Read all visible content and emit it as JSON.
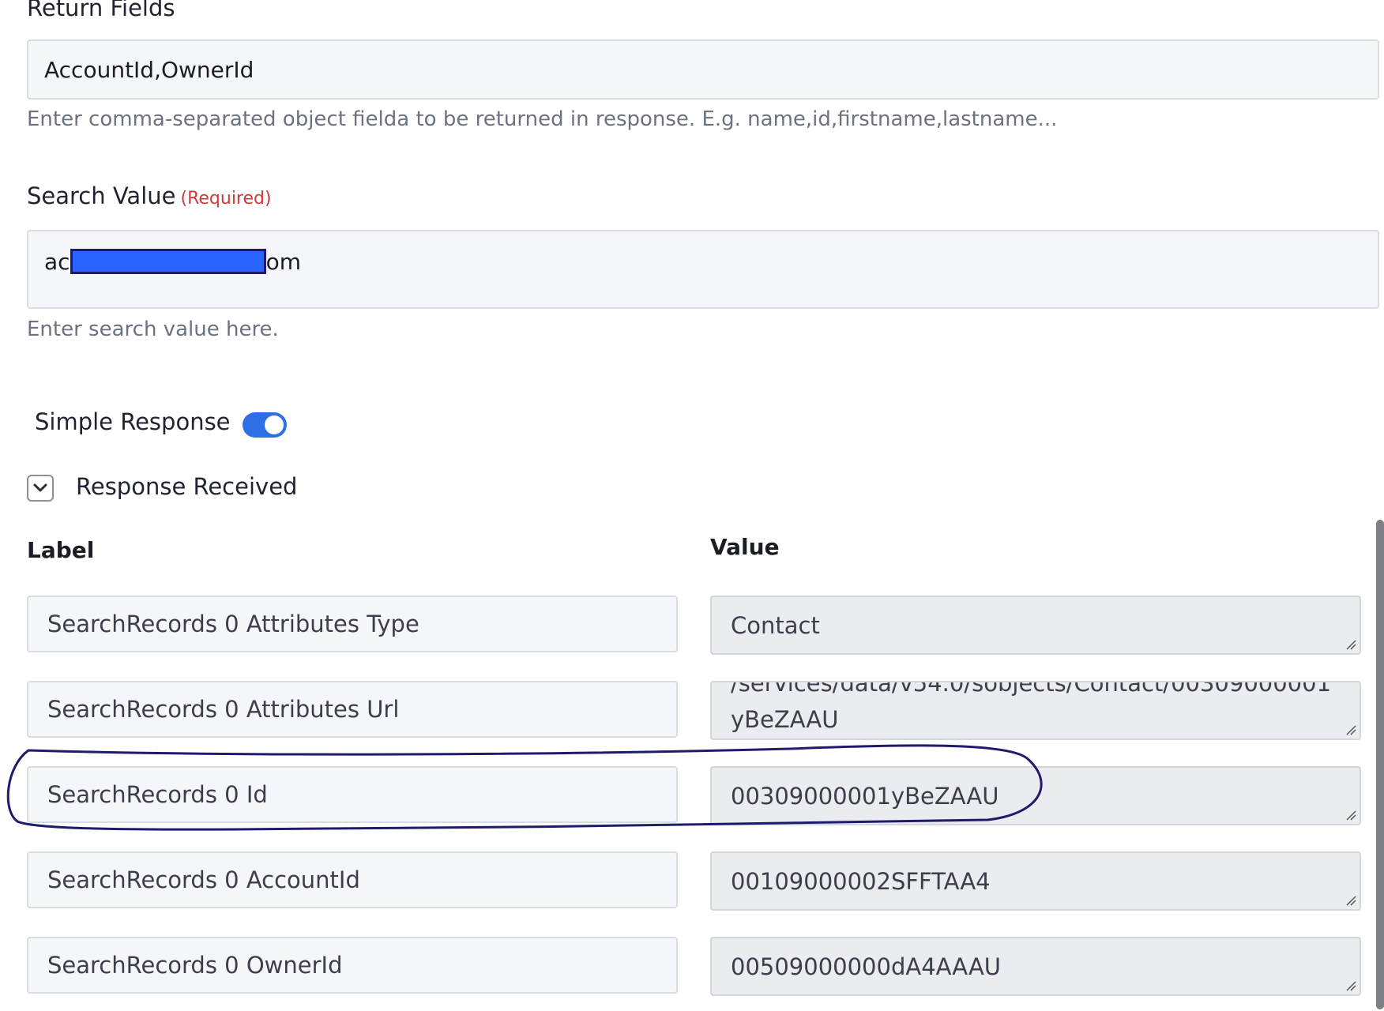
{
  "return_fields": {
    "label": "Return Fields",
    "value": "AccountId,OwnerId",
    "help": "Enter comma-separated object fielda to be returned in response. E.g. name,id,firstname,lastname..."
  },
  "search_value": {
    "label": "Search Value",
    "required": "(Required)",
    "value_prefix": "ac",
    "value_suffix": "om",
    "help": "Enter search value here."
  },
  "simple_response": {
    "label": "Simple Response",
    "enabled": true
  },
  "response_received": {
    "label": "Response Received",
    "expanded": true
  },
  "response_table": {
    "label_header": "Label",
    "value_header": "Value",
    "rows": [
      {
        "label": "SearchRecords 0 Attributes Type",
        "value": "Contact"
      },
      {
        "label": "SearchRecords 0 Attributes Url",
        "value": "/services/data/v54.0/sobjects/Contact/00309000001yBeZAAU"
      },
      {
        "label": "SearchRecords 0 Id",
        "value": "00309000001yBeZAAU"
      },
      {
        "label": "SearchRecords 0 AccountId",
        "value": "00109000002SFFTAA4"
      },
      {
        "label": "SearchRecords 0 OwnerId",
        "value": "00509000000dA4AAAU"
      }
    ]
  },
  "colors": {
    "accent": "#2f6fe6",
    "required": "#d53a3a",
    "annotation": "#1f1b6b",
    "redaction": "#2962ff"
  }
}
